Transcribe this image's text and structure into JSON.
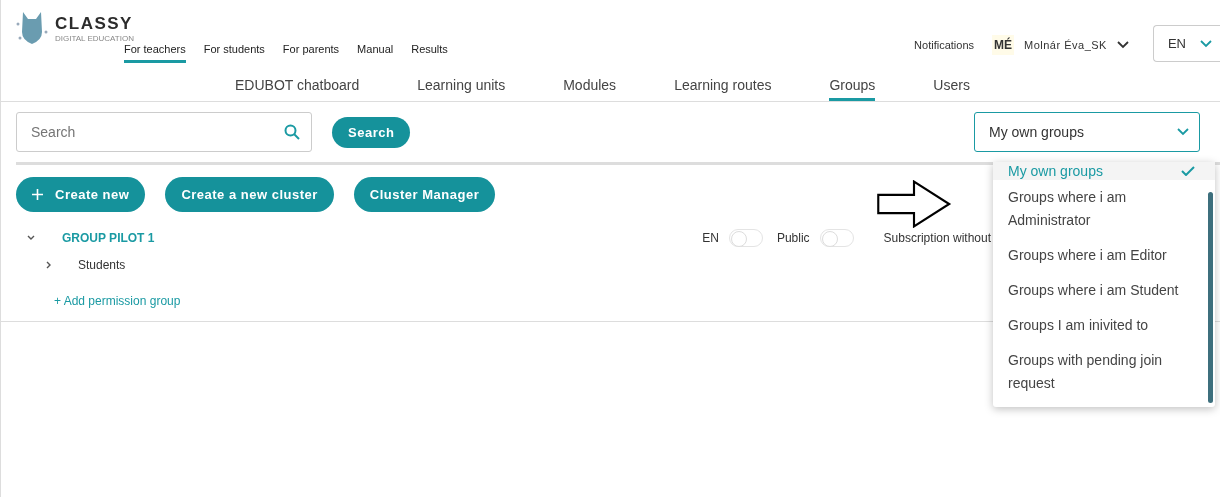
{
  "logo": {
    "name": "CLASSY",
    "tagline": "DIGITAL EDUCATION"
  },
  "top_nav": [
    {
      "label": "For teachers",
      "selected": true
    },
    {
      "label": "For students",
      "selected": false
    },
    {
      "label": "For parents",
      "selected": false
    },
    {
      "label": "Manual",
      "selected": false
    },
    {
      "label": "Results",
      "selected": false
    }
  ],
  "user_bar": {
    "notifications": "Notifications",
    "initials": "MÉ",
    "user": "Molnár Éva_SK",
    "language": "EN"
  },
  "sub_nav": [
    {
      "label": "EDUBOT chatboard",
      "selected": false
    },
    {
      "label": "Learning units",
      "selected": false
    },
    {
      "label": "Modules",
      "selected": false
    },
    {
      "label": "Learning routes",
      "selected": false
    },
    {
      "label": "Groups",
      "selected": true
    },
    {
      "label": "Users",
      "selected": false
    }
  ],
  "search": {
    "placeholder": "Search",
    "button": "Search"
  },
  "filter": {
    "value": "My own groups",
    "options": [
      {
        "label": "My own groups",
        "selected": true
      },
      {
        "label": "Groups where i am Administrator",
        "selected": false
      },
      {
        "label": "Groups where i am Editor",
        "selected": false
      },
      {
        "label": "Groups where i am Student",
        "selected": false
      },
      {
        "label": "Groups I am inivited to",
        "selected": false
      },
      {
        "label": "Groups with pending join request",
        "selected": false
      }
    ]
  },
  "actions": [
    {
      "label": "Create new",
      "plus": true
    },
    {
      "label": "Create a new cluster",
      "plus": false
    },
    {
      "label": "Cluster Manager",
      "plus": false
    }
  ],
  "group": {
    "name": "GROUP PILOT 1",
    "expanded": true,
    "toggles": [
      {
        "label": "EN",
        "on": false
      },
      {
        "label": "Public",
        "on": false
      }
    ],
    "extra_label": "Subscription without",
    "children": [
      {
        "name": "Students",
        "expanded": false
      }
    ],
    "add_link": "+ Add permission group"
  }
}
